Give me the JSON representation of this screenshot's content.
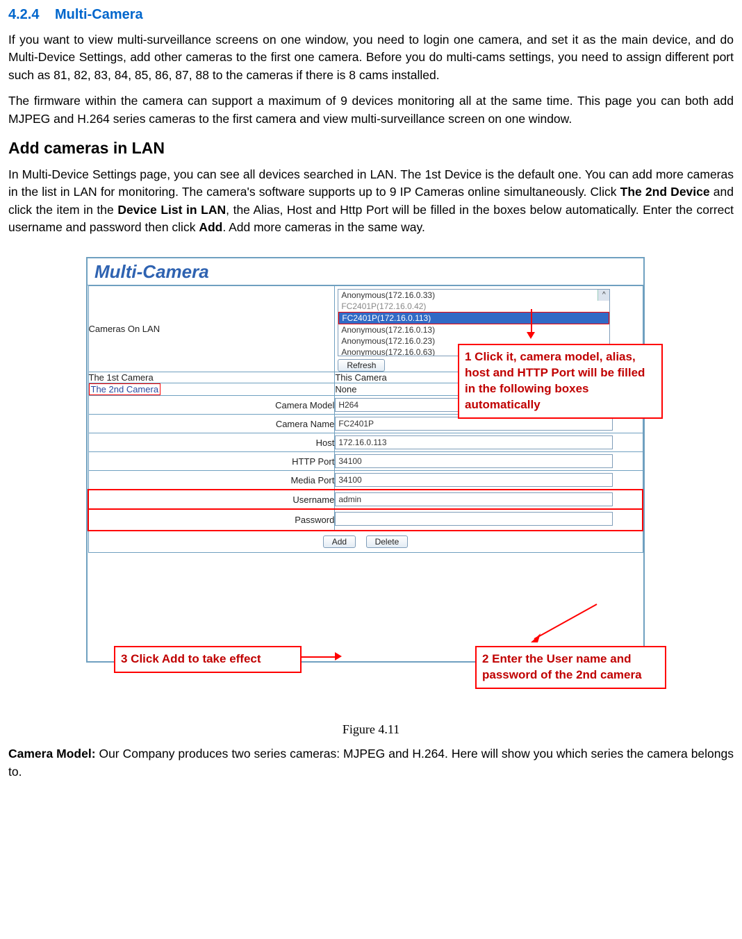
{
  "section": {
    "num": "4.2.4",
    "title": "Multi-Camera"
  },
  "p1": "If you want to view multi-surveillance screens on one window, you need to login one camera, and set it as the main device, and do Multi-Device Settings, add other cameras to the first one camera. Before you do multi-cams settings, you need to assign different port such as 81, 82, 83, 84, 85, 86, 87, 88 to the cameras if there is 8 cams installed.",
  "p2": "The firmware within the camera can support a maximum of 9 devices monitoring all at the same time. This page you can both add MJPEG and H.264 series cameras to the first camera and view multi-surveillance screen on one window.",
  "h2": "Add cameras in LAN",
  "p3_a": "In Multi-Device Settings page, you can see all devices searched in LAN. The 1st Device is the default one. You can add more cameras in the list in LAN for monitoring. The camera's software supports up to 9 IP Cameras online simultaneously. Click ",
  "p3_b": "The 2nd Device",
  "p3_c": " and click the item in the ",
  "p3_d": "Device List in LAN",
  "p3_e": ", the Alias, Host and Http Port will be filled in the boxes below automatically. Enter the correct username and password then click ",
  "p3_f": "Add",
  "p3_g": ". Add more cameras in the same way.",
  "panel": {
    "title": "Multi-Camera",
    "lan_label": "Cameras On LAN",
    "list": {
      "i0": "Anonymous(172.16.0.33)",
      "i1": "FC2401P(172.16.0.42)",
      "i2": "FC2401P(172.16.0.113)",
      "i3": "Anonymous(172.16.0.13)",
      "i4": "Anonymous(172.16.0.23)",
      "i5": "Anonymous(172.16.0.63)"
    },
    "refresh": "Refresh",
    "cam1_lbl": "The 1st Camera",
    "cam1_val": "This Camera",
    "cam2_lbl": "The 2nd Camera",
    "cam2_val": "None",
    "model_lbl": "Camera Model",
    "model_val": "H264",
    "name_lbl": "Camera Name",
    "name_val": "FC2401P",
    "host_lbl": "Host",
    "host_val": "172.16.0.113",
    "http_lbl": "HTTP Port",
    "http_val": "34100",
    "media_lbl": "Media Port",
    "media_val": "34100",
    "user_lbl": "Username",
    "user_val": "admin",
    "pass_lbl": "Password",
    "pass_val": "",
    "add": "Add",
    "del": "Delete"
  },
  "callout1": "1 Click it, camera model, alias, host and HTTP Port will be filled in the following boxes automatically",
  "callout2": "2 Enter the User name and password of the 2nd camera",
  "callout3": "3 Click Add to take effect",
  "figcap": "Figure 4.11",
  "p4_a": "Camera Model:",
  "p4_b": " Our Company produces two series cameras: MJPEG and H.264. Here will show you which series the camera belongs to."
}
